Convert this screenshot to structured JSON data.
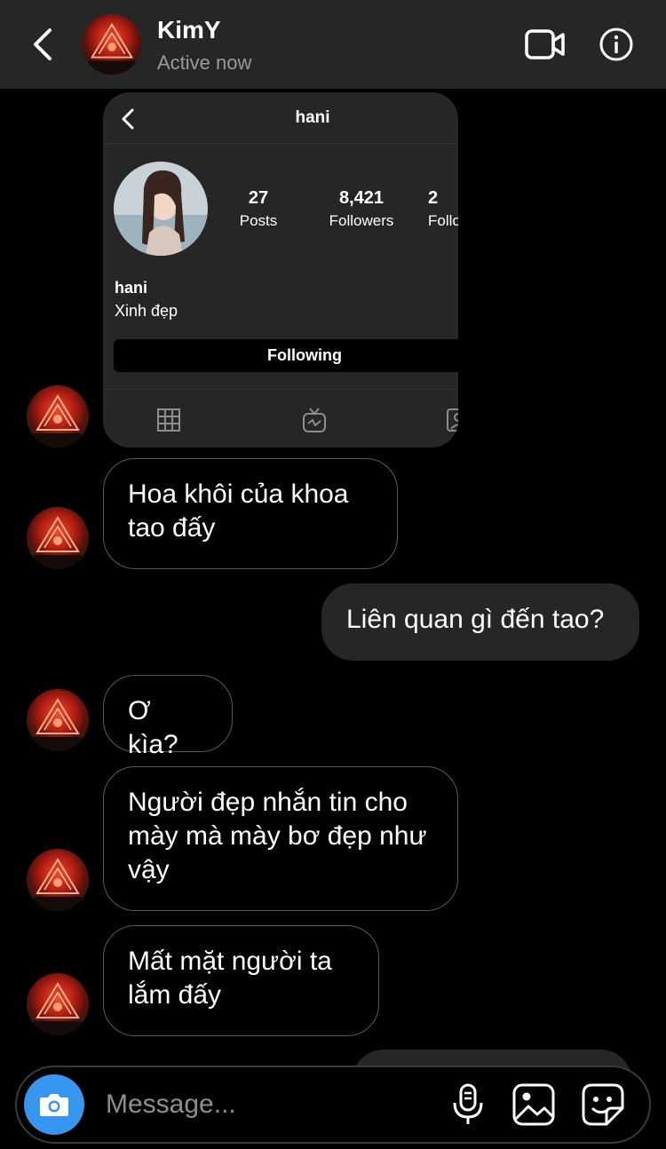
{
  "header": {
    "title": "KimY",
    "status": "Active now",
    "icons": {
      "back": "chevron-left-icon",
      "video": "video-camera-icon",
      "info": "info-icon"
    }
  },
  "shared_profile": {
    "username": "hani",
    "name": "hani",
    "bio": "Xinh đẹp",
    "stats": [
      {
        "value": "27",
        "label": "Posts"
      },
      {
        "value": "8,421",
        "label": "Followers"
      },
      {
        "value": "2",
        "label": "Follo"
      }
    ],
    "follow_button": "Following",
    "tab_icons": [
      "grid-icon",
      "igtv-icon",
      "tagged-icon"
    ]
  },
  "messages": [
    {
      "sender": "KimY",
      "text": "Hoa khôi của khoa tao đấy"
    },
    {
      "sender": "me",
      "text": "Liên quan gì đến tao?"
    },
    {
      "sender": "KimY",
      "text": "Ơ kìa?"
    },
    {
      "sender": "KimY",
      "text": "Người đẹp nhắn tin cho mày mà mày bơ đẹp như vậy"
    },
    {
      "sender": "KimY",
      "text": "Mất mặt người ta lắm đấy"
    }
  ],
  "composer": {
    "placeholder": "Message...",
    "icons": {
      "camera": "camera-icon",
      "mic": "microphone-icon",
      "gallery": "image-icon",
      "sticker": "sticker-icon"
    }
  },
  "colors": {
    "header_bg": "#262626",
    "bubble_mine": "#262626",
    "accent": "#3797f0"
  }
}
